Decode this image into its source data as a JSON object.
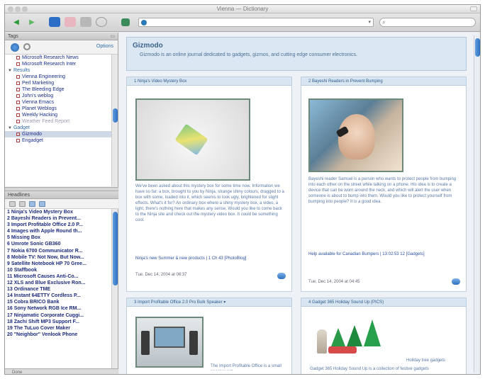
{
  "window": {
    "title": "Vienna — Dictionary"
  },
  "toolbar": {
    "address_value": "",
    "search_placeholder": ""
  },
  "sidebar": {
    "header": "Tags",
    "options_label": "Options",
    "items": [
      {
        "label": "Microsoft Research News",
        "kind": "feed"
      },
      {
        "label": "Microsoft Research Inter",
        "kind": "feed"
      },
      {
        "label": "Results",
        "kind": "group"
      },
      {
        "label": "Vienna Engineering",
        "kind": "feed"
      },
      {
        "label": "Perl Marketing",
        "kind": "feed"
      },
      {
        "label": "The Bleeding Edge",
        "kind": "feed"
      },
      {
        "label": "John's weblog",
        "kind": "feed"
      },
      {
        "label": "Vienna Emacs",
        "kind": "feed"
      },
      {
        "label": "Planet Weblogs",
        "kind": "feed"
      },
      {
        "label": "Weekly Hacking",
        "kind": "feed"
      },
      {
        "label": "Weather Feed Report",
        "kind": "feed-dim"
      },
      {
        "label": "Gadget",
        "kind": "group"
      },
      {
        "label": "Gizmodo",
        "kind": "selected"
      },
      {
        "label": "Engadget",
        "kind": "feed"
      }
    ]
  },
  "headlines": {
    "header": "Headlines",
    "items": [
      "1 Ninja's Video Mystery Box",
      "2 Bayeshi Readers in Prevent...",
      "3 Import Profitable Office 2.0 P...",
      "4 Images with Apple Round th...",
      "5 Missing Box",
      "6 Umrote Sonic GB360",
      "7 Nokia 6700 Communicator R...",
      "8 Mobile TV: Not Now, But Now...",
      "9 Satellite Notebook HP 70 Gree...",
      "10 Staffbook",
      "11 Microsoft Causes Anti-Co...",
      "12 XLS and Blue Exclusive Ron...",
      "13 Ordinance TME",
      "14 Instant 64ETTY Cordless P...",
      "15 Cobra BRICO Bank",
      "16 Sony Network RGB Ice RM...",
      "17 Ninjamatic Corporate Cuggi...",
      "18 Zachi Shift MP3 Support F...",
      "19 The TuLuo Cover Maker",
      "20 \"Neighbor\" Venlook Phone"
    ],
    "status": "Done"
  },
  "main": {
    "feed_title": "Gizmodo",
    "feed_description": "Gizmodo is an online journal dedicated to gadgets, gizmos, and cutting edge consumer electronics.",
    "articles": [
      {
        "title": "1  Ninja's Video Mystery Box",
        "body": "We've been asked about this mystery box for some time now. Information we have so far: a box, brought to you by Ninja, strange shiny colours, dragged to a box with some, loaded into it, which seems to look ugly, brightened for slight effects. What's it for? An ordinary box where a shiny mystery box, a video, a light, there's nothing here that makes any sense. Would you like to come back to the Ninja site and check out the mystery video box. It could be something cool.",
        "link": "Ninja's new Summer & new products | 1 Ch 43 [PhotoBlog]",
        "date": "Tue, Dec 14, 2004 at 06:37"
      },
      {
        "title": "2  Bayeshi Readers in Prevent Bumping",
        "body": "Bayeshi reader Samuel is a person who wants to protect people from bumping into each other on the street while talking on a phone. His idea is to create a device that can be worn around the neck, and which will alert the user when someone is about to bump into them. Would you like to protect yourself from bumping into people? It is a good idea.",
        "link": "Help available for Canadian Bumpers | 13:02:53 12 [Gadgets]",
        "date": "Tue, Dec 14, 2004 at 04:45"
      },
      {
        "title": "3  Import Profitable Office 2.0 Pro Bulk Speaker ▾",
        "body": "The Import Profitable Office is a small speaker set",
        "date": ""
      },
      {
        "title": "4  Gadget 365 Holiday Sound Up (PICS)",
        "body": "Gadget 365 Holiday Sound Up is a collection of festive gadgets",
        "caption": "Holiday tree gadgets",
        "date": ""
      }
    ]
  },
  "colors": {
    "accent": "#2f6fbf",
    "banner_bg": "#dbe7f2",
    "card_header_bg": "#d8e6f2",
    "headline_text": "#1d2c7c"
  }
}
